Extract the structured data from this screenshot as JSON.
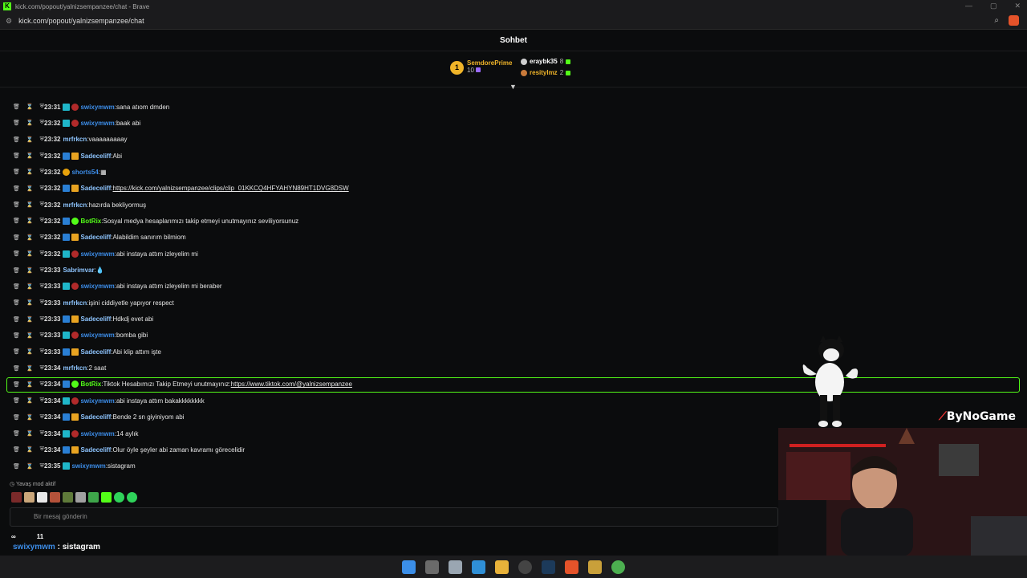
{
  "browser": {
    "window_title": "kick.com/popout/yalnizsempanzee/chat - Brave",
    "url": "kick.com/popout/yalnizsempanzee/chat"
  },
  "chat": {
    "header_title": "Sohbet",
    "leaderboard": {
      "first": {
        "rank": "1",
        "name": "SemdorePrime",
        "count": "10"
      },
      "second": {
        "name": "eraybk35",
        "count": "8"
      },
      "third": {
        "name": "resitylmz",
        "count": "2"
      }
    },
    "messages": [
      {
        "time": "23:31",
        "badges": [
          "sub",
          "red"
        ],
        "user": "swixymwm",
        "user_style": "blue",
        "text": "sana atıom dmden"
      },
      {
        "time": "23:32",
        "badges": [
          "sub",
          "red"
        ],
        "user": "swixymwm",
        "user_style": "blue",
        "text": "baak abi"
      },
      {
        "time": "23:32",
        "badges": [],
        "user": "mrfrkcn",
        "user_style": "light",
        "text": "vaaaaaaaaay"
      },
      {
        "time": "23:32",
        "badges": [
          "mod",
          "vip"
        ],
        "user": "Sadeceliff",
        "user_style": "light",
        "text": "Abi"
      },
      {
        "time": "23:32",
        "badges": [
          "gold"
        ],
        "user": "shorts54",
        "user_style": "blue",
        "text": "▦"
      },
      {
        "time": "23:32",
        "badges": [
          "mod",
          "vip"
        ],
        "user": "Sadeceliff",
        "user_style": "light",
        "text": "",
        "link": "https://kick.com/yalnizsempanzee/clips/clip_01KKCQ4HFYAHYN89HT1DVG8DSW"
      },
      {
        "time": "23:32",
        "badges": [],
        "user": "mrfrkcn",
        "user_style": "light",
        "text": "hazırda bekliyormuş"
      },
      {
        "time": "23:32",
        "badges": [
          "mod",
          "bot"
        ],
        "user": "BotRix",
        "user_style": "green",
        "text": "Sosyal medya hesaplarımızı takip etmeyi unutmayınız seviliyorsunuz"
      },
      {
        "time": "23:32",
        "badges": [
          "mod",
          "vip"
        ],
        "user": "Sadeceliff",
        "user_style": "light",
        "text": "Alabildim sanırım bilmiom"
      },
      {
        "time": "23:32",
        "badges": [
          "sub",
          "red"
        ],
        "user": "swixymwm",
        "user_style": "blue",
        "text": "abi instaya attım izleyelim mi"
      },
      {
        "time": "23:33",
        "badges": [],
        "user": "Sabrimvar",
        "user_style": "light",
        "text": "💧"
      },
      {
        "time": "23:33",
        "badges": [
          "sub",
          "red"
        ],
        "user": "swixymwm",
        "user_style": "blue",
        "text": "abi instaya attım izleyelim mi beraber"
      },
      {
        "time": "23:33",
        "badges": [],
        "user": "mrfrkcn",
        "user_style": "light",
        "text": "işini ciddiyetle yapıyor respect"
      },
      {
        "time": "23:33",
        "badges": [
          "mod",
          "vip"
        ],
        "user": "Sadeceliff",
        "user_style": "light",
        "text": "Hdkdj evet abi"
      },
      {
        "time": "23:33",
        "badges": [
          "sub",
          "red"
        ],
        "user": "swixymwm",
        "user_style": "blue",
        "text": "bomba gibi"
      },
      {
        "time": "23:33",
        "badges": [
          "mod",
          "vip"
        ],
        "user": "Sadeceliff",
        "user_style": "light",
        "text": "Abi klip attım işte"
      },
      {
        "time": "23:34",
        "badges": [],
        "user": "mrfrkcn",
        "user_style": "light",
        "text": "2 saat"
      },
      {
        "time": "23:34",
        "badges": [
          "mod",
          "bot"
        ],
        "user": "BotRix",
        "user_style": "green",
        "text": "Tiktok Hesabımızı Takip Etmeyi unutmayınız: ",
        "link": "https://www.tiktok.com/@yalnizsempanzee"
      },
      {
        "time": "23:34",
        "badges": [
          "sub",
          "red"
        ],
        "user": "swixymwm",
        "user_style": "blue",
        "text": "abi instaya attım bakakkkkkkkk"
      },
      {
        "time": "23:34",
        "badges": [
          "mod",
          "vip"
        ],
        "user": "Sadeceliff",
        "user_style": "light",
        "text": "Bende 2 sn giyiniyom abi"
      },
      {
        "time": "23:34",
        "badges": [
          "sub",
          "red"
        ],
        "user": "swixymwm",
        "user_style": "blue",
        "text": "14 aylık"
      },
      {
        "time": "23:34",
        "badges": [
          "mod",
          "vip"
        ],
        "user": "Sadeceliff",
        "user_style": "light",
        "text": "Olur öyle şeyler abi zaman kavramı görecelidir"
      },
      {
        "time": "23:35",
        "badges": [
          "sub"
        ],
        "user": "swixymwm",
        "user_style": "blue",
        "text": "sistagram"
      }
    ],
    "slow_mode": "Yavaş mod aktif",
    "input_placeholder": "Bir mesaj gönderin"
  },
  "overlay": {
    "stat_infinite": "∞",
    "stat_count": "11",
    "last_user": "swixymwm",
    "last_text": " : sistagram",
    "sponsor": "ByNoGame"
  },
  "colors": {
    "accent": "#53fc18",
    "mod_blue": "#3c8ce7"
  }
}
